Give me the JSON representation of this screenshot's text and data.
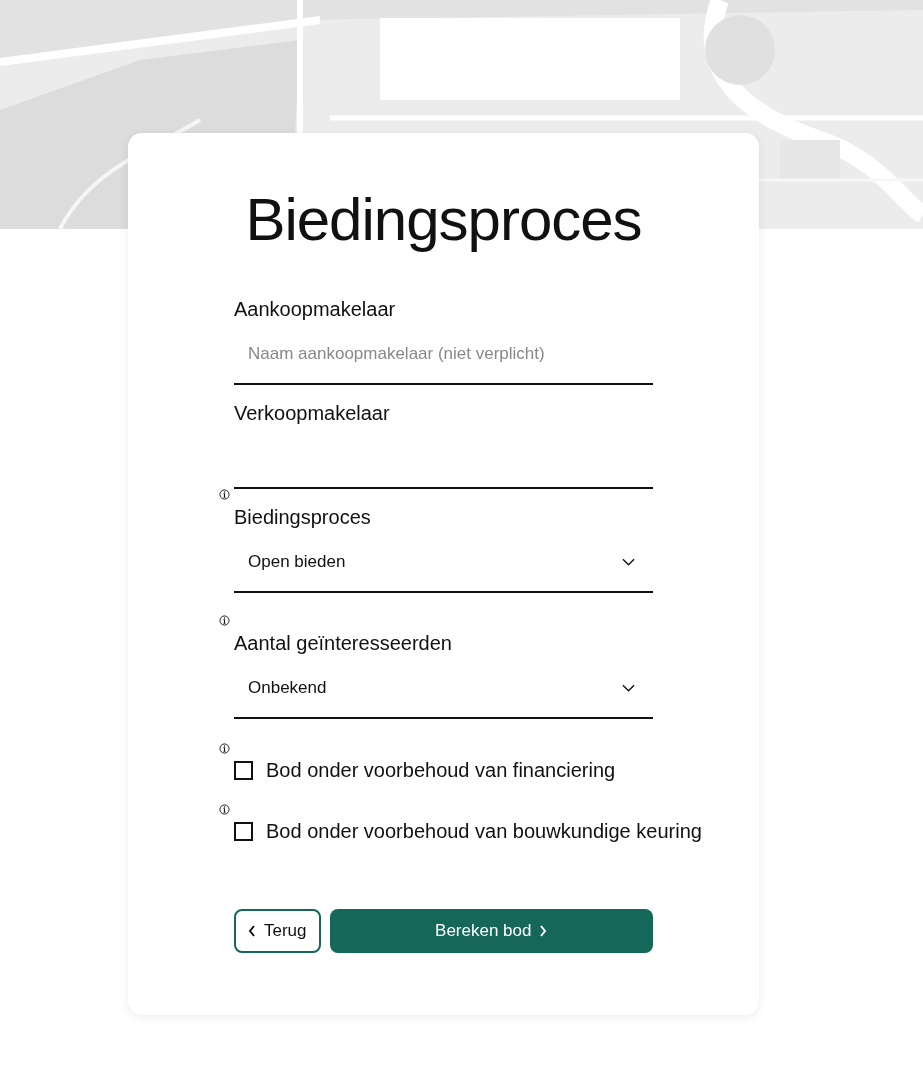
{
  "title": "Biedingsproces",
  "fields": [
    {
      "kind": "text",
      "label": "Aankoopmakelaar",
      "placeholder": "Naam aankoopmakelaar (niet verplicht)",
      "info": false
    },
    {
      "kind": "text",
      "label": "Verkoopmakelaar",
      "info": false
    },
    {
      "kind": "select",
      "label": "Biedingsproces",
      "value": "Open bieden",
      "info": true
    },
    {
      "kind": "select",
      "label": "Aantal geïnteresseerden",
      "value": "Onbekend",
      "info": true
    },
    {
      "kind": "checkbox",
      "label": "Bod onder voorbehoud van financiering",
      "checked": false,
      "info": true
    },
    {
      "kind": "checkbox",
      "label": "Bod onder voorbehoud van bouwkundige keuring",
      "checked": false,
      "info": true
    }
  ],
  "buttons": {
    "back": "Terug",
    "next": "Bereken bod"
  }
}
